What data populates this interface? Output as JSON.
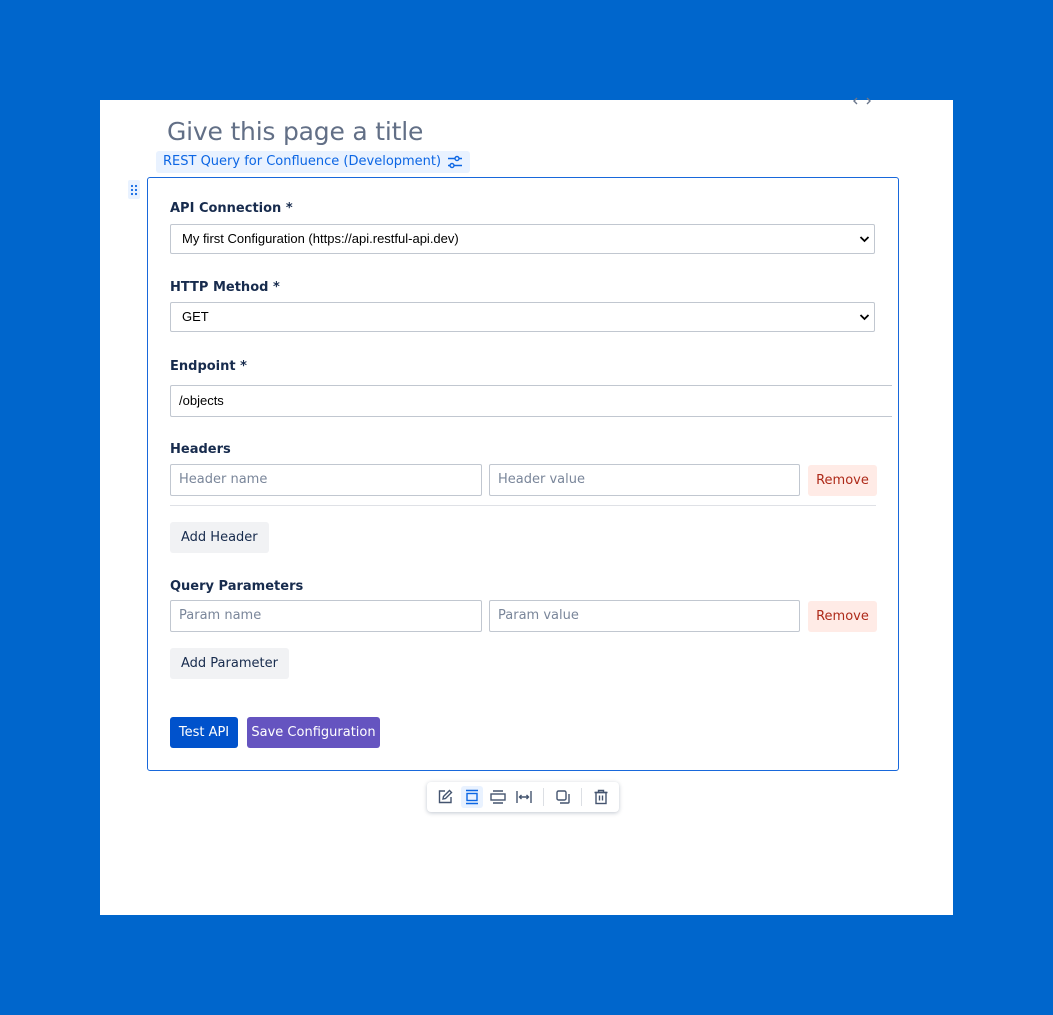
{
  "page": {
    "title_placeholder": "Give this page a title"
  },
  "macro": {
    "label": "REST Query for Confluence (Development)",
    "settings_icon": "sliders-icon",
    "drag_icon": "drag-handle-icon"
  },
  "form": {
    "api_connection": {
      "label": "API Connection *",
      "selected": "My first Configuration (https://api.restful-api.dev)"
    },
    "http_method": {
      "label": "HTTP Method *",
      "selected": "GET"
    },
    "endpoint": {
      "label": "Endpoint *",
      "value": "/objects"
    },
    "headers": {
      "label": "Headers",
      "rows": [
        {
          "name_placeholder": "Header name",
          "value_placeholder": "Header value",
          "remove_label": "Remove"
        }
      ],
      "add_label": "Add Header"
    },
    "query_params": {
      "label": "Query Parameters",
      "rows": [
        {
          "name_placeholder": "Param name",
          "value_placeholder": "Param value",
          "remove_label": "Remove"
        }
      ],
      "add_label": "Add Parameter"
    },
    "test_label": "Test API",
    "save_label": "Save Configuration"
  },
  "toolbar": {
    "items": [
      "edit-icon",
      "center-layout-icon",
      "wide-layout-icon",
      "full-width-icon",
      "copy-icon",
      "delete-icon"
    ]
  },
  "colors": {
    "background": "#0066cc",
    "primary": "#0052cc",
    "save": "#6554c0",
    "remove_bg": "#ffebe6",
    "remove_text": "#ae2a19"
  }
}
